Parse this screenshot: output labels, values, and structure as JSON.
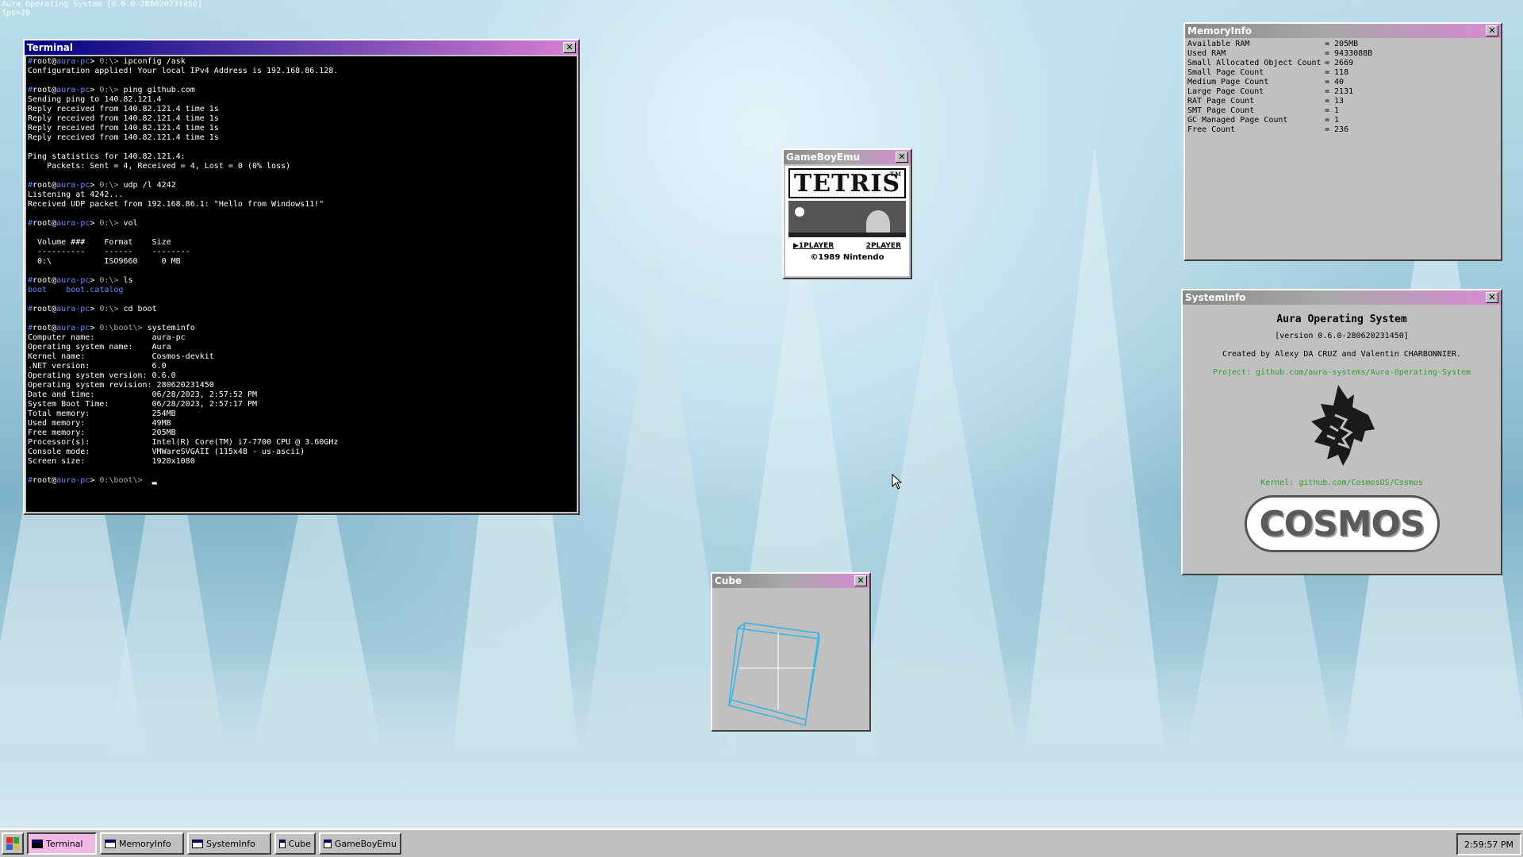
{
  "system": {
    "title": "Aura Operating System [0.6.0-2806202314​50]",
    "fps": "fps=20"
  },
  "terminal": {
    "title": "Terminal",
    "lines": [
      {
        "pu": "root",
        "pa": "aura-pc",
        "pre": "0:\\>",
        "cmd": "ipconfig /ask"
      },
      {
        "text": "Configuration applied! Your local IPv4 Address is 192.168.86.128."
      },
      {
        "text": ""
      },
      {
        "pu": "root",
        "pa": "aura-pc",
        "pre": "0:\\>",
        "cmd": "ping github.com"
      },
      {
        "text": "Sending ping to 140.82.121.4"
      },
      {
        "text": "Reply received from 140.82.121.4 time 1s"
      },
      {
        "text": "Reply received from 140.82.121.4 time 1s"
      },
      {
        "text": "Reply received from 140.82.121.4 time 1s"
      },
      {
        "text": "Reply received from 140.82.121.4 time 1s"
      },
      {
        "text": ""
      },
      {
        "text": "Ping statistics for 140.82.121.4:"
      },
      {
        "text": "    Packets: Sent = 4, Received = 4, Lost = 0 (0% loss)"
      },
      {
        "text": ""
      },
      {
        "pu": "root",
        "pa": "aura-pc",
        "pre": "0:\\>",
        "cmd": "udp /l 4242"
      },
      {
        "text": "Listening at 4242..."
      },
      {
        "text": "Received UDP packet from 192.168.86.1: \"Hello from Windows11!\""
      },
      {
        "text": ""
      },
      {
        "pu": "root",
        "pa": "aura-pc",
        "pre": "0:\\>",
        "cmd": "vol"
      },
      {
        "text": ""
      },
      {
        "text": "  Volume ###    Format    Size"
      },
      {
        "text": "  ----------    ------    --------"
      },
      {
        "text": "  0:\\           ISO9660     0 MB"
      },
      {
        "text": ""
      },
      {
        "pu": "root",
        "pa": "aura-pc",
        "pre": "0:\\>",
        "cmd": "ls"
      },
      {
        "dir1": "boot",
        "dir2": "boot.catalog"
      },
      {
        "text": ""
      },
      {
        "pu": "root",
        "pa": "aura-pc",
        "pre": "0:\\>",
        "cmd": "cd boot"
      },
      {
        "text": ""
      },
      {
        "pu": "root",
        "pa": "aura-pc",
        "pre": "0:\\boot\\>",
        "cmd": "systeminfo"
      },
      {
        "text": "Computer name:            aura-pc"
      },
      {
        "text": "Operating system name:    Aura"
      },
      {
        "text": "Kernel name:              Cosmos-devkit"
      },
      {
        "text": ".NET version:             6.0"
      },
      {
        "text": "Operating system version: 0.6.0"
      },
      {
        "text": "Operating system revision: 280620231450"
      },
      {
        "text": "Date and time:            06/28/2023, 2:57:52 PM"
      },
      {
        "text": "System Boot Time:         06/28/2023, 2:57:17 PM"
      },
      {
        "text": "Total memory:             254MB"
      },
      {
        "text": "Used memory:              49MB"
      },
      {
        "text": "Free memory:              205MB"
      },
      {
        "text": "Processor(s):             Intel(R) Core(TM) i7-7700 CPU @ 3.60GHz"
      },
      {
        "text": "Console mode:             VMWareSVGAII (115x48 - us-ascii)"
      },
      {
        "text": "Screen size:              1920x1080"
      },
      {
        "text": ""
      },
      {
        "pu": "root",
        "pa": "aura-pc",
        "pre": "0:\\boot\\>",
        "cmd": "",
        "cursor": true
      }
    ]
  },
  "memory": {
    "title": "MemoryInfo",
    "rows": [
      {
        "k": "Available RAM",
        "v": "= 205MB"
      },
      {
        "k": "Used RAM",
        "v": "= 9433088B"
      },
      {
        "k": "Small Allocated Object Count",
        "v": "= 2669"
      },
      {
        "k": "Small Page Count",
        "v": "= 118"
      },
      {
        "k": "Medium Page Count",
        "v": "= 40"
      },
      {
        "k": "Large Page Count",
        "v": "= 2131"
      },
      {
        "k": "RAT Page Count",
        "v": "= 13"
      },
      {
        "k": "SMT Page Count",
        "v": "= 1"
      },
      {
        "k": "GC Managed Page Count",
        "v": "= 1"
      },
      {
        "k": "Free Count",
        "v": "= 236"
      }
    ]
  },
  "sysinfo": {
    "title": "SystemInfo",
    "heading": "Aura Operating System",
    "version": "[version 0.6.0-280620231450]",
    "credits": "Created by Alexy DA CRUZ and Valentin CHARBONNIER.",
    "project": "Project: github.com/aura-systems/Aura-Operating-System",
    "kernel": "Kernel: github.com/CosmosOS/Cosmos",
    "cosmos_logo": "COSMOS"
  },
  "gameboy": {
    "title": "GameBoyEmu",
    "logo": "TETRIS",
    "tm": "TM",
    "p1": "▶1PLAYER",
    "p2": "2PLAYER",
    "copyright": "©1989 Nintendo"
  },
  "cube": {
    "title": "Cube"
  },
  "taskbar": {
    "items": [
      {
        "label": "Terminal"
      },
      {
        "label": "MemoryInfo"
      },
      {
        "label": "SystemInfo"
      },
      {
        "label": "Cube"
      },
      {
        "label": "GameBoyEmu"
      }
    ],
    "clock": "2:59:57 PM"
  },
  "colors": {
    "titlebar": "#000080",
    "titlebar_end": "#d97fd4",
    "prompt_user": "#5f8cff",
    "link_green": "#2f9e2f",
    "cube_line": "#35b4e8"
  }
}
